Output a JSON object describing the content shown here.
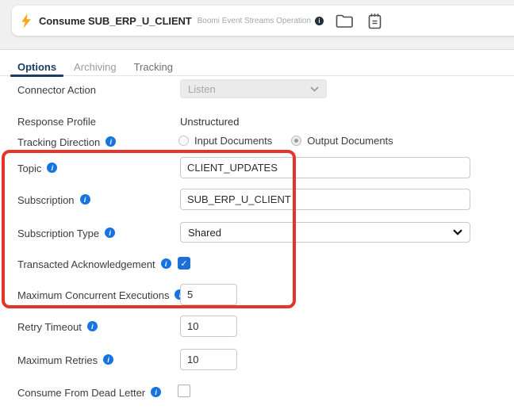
{
  "header": {
    "title": "Consume SUB_ERP_U_CLIENT",
    "subtitle": "Boomi Event Streams Operation",
    "info_glyph": "i"
  },
  "tabs": {
    "options": "Options",
    "archiving": "Archiving",
    "tracking": "Tracking"
  },
  "form": {
    "connector_action": {
      "label": "Connector Action",
      "value": "Listen",
      "disabled": true
    },
    "response_profile": {
      "label": "Response Profile",
      "value": "Unstructured"
    },
    "tracking_direction": {
      "label": "Tracking Direction",
      "options": [
        "Input Documents",
        "Output Documents"
      ],
      "selected": "Output Documents"
    },
    "topic": {
      "label": "Topic",
      "value": "CLIENT_UPDATES"
    },
    "subscription": {
      "label": "Subscription",
      "value": "SUB_ERP_U_CLIENT"
    },
    "subscription_type": {
      "label": "Subscription Type",
      "value": "Shared"
    },
    "transacted_acknowledgement": {
      "label": "Transacted Acknowledgement",
      "checked": true,
      "check_glyph": "✓"
    },
    "maximum_concurrent_executions": {
      "label": "Maximum Concurrent Executions",
      "value": "5"
    },
    "retry_timeout": {
      "label": "Retry Timeout",
      "value": "10"
    },
    "maximum_retries": {
      "label": "Maximum Retries",
      "value": "10"
    },
    "consume_from_dead_letter": {
      "label": "Consume From Dead Letter",
      "checked": false
    }
  },
  "info_glyph": "i",
  "colors": {
    "info_blue": "#1673E0",
    "annotation_red": "#E5352B",
    "tab_active_navy": "#1D3B63",
    "bolt_yellow": "#F9A61A",
    "checkbox_blue": "#1F6FD4"
  }
}
